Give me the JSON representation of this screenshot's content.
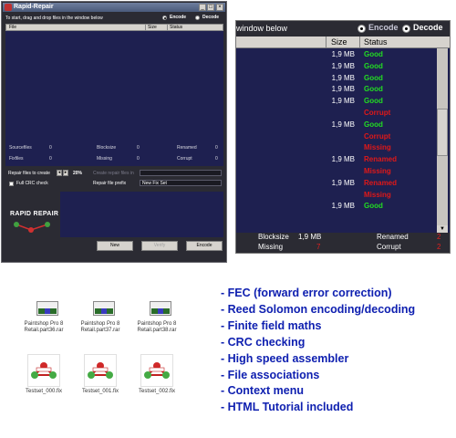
{
  "window": {
    "title": "Rapid-Repair",
    "instruction": "To start, drag and drop files in the window below",
    "encode_label": "Encode",
    "decode_label": "Decode",
    "columns": {
      "file": "File",
      "size": "Size",
      "status": "Status"
    },
    "stats": {
      "sourcefiles_label": "Sourcefiles",
      "sourcefiles": "0",
      "fixfiles_label": "Fixfiles",
      "fixfiles": "0",
      "blocksize_label": "Blocksize",
      "blocksize": "0",
      "missing_label": "Missing",
      "missing": "0",
      "renamed_label": "Renamed",
      "renamed": "0",
      "corrupt_label": "Corrupt",
      "corrupt": "0"
    },
    "repair_files_label": "Repair files to create",
    "repair_percent": "20%",
    "create_repair_label": "Create repair files in",
    "full_crc_label": "Full CRC check",
    "prefix_label": "Repair file prefix",
    "prefix_value": "New Fix Set",
    "logo_text": "RAPID REPAIR",
    "buttons": {
      "new": "New",
      "verify": "Verify",
      "encode": "Encode"
    }
  },
  "zoom": {
    "instruction_tail": "window below",
    "encode_label": "Encode",
    "decode_label": "Decode",
    "columns": {
      "size": "Size",
      "status": "Status"
    },
    "rows": [
      {
        "size": "1,9 MB",
        "status": "Good"
      },
      {
        "size": "1,9 MB",
        "status": "Good"
      },
      {
        "size": "1,9 MB",
        "status": "Good"
      },
      {
        "size": "1,9 MB",
        "status": "Good"
      },
      {
        "size": "1,9 MB",
        "status": "Good"
      },
      {
        "size": "",
        "status": "Corrupt"
      },
      {
        "size": "1,9 MB",
        "status": "Good"
      },
      {
        "size": "",
        "status": "Corrupt"
      },
      {
        "size": "",
        "status": "Missing"
      },
      {
        "size": "1,9 MB",
        "status": "Renamed"
      },
      {
        "size": "",
        "status": "Missing"
      },
      {
        "size": "1,9 MB",
        "status": "Renamed"
      },
      {
        "size": "",
        "status": "Missing"
      },
      {
        "size": "1,9 MB",
        "status": "Good"
      }
    ],
    "blocksize_label": "Blocksize",
    "blocksize": "1,9 MB",
    "missing_label": "Missing",
    "missing": "7",
    "renamed_label": "Renamed",
    "renamed": "2",
    "corrupt_label": "Corrupt",
    "corrupt": "2"
  },
  "status_colors": {
    "Good": "#22dd22",
    "Corrupt": "#e01818",
    "Missing": "#e01818",
    "Renamed": "#e01818"
  },
  "files": [
    {
      "name": "Paintshop Pro 8 Retail.part36.rar",
      "icon": "rar-archive-icon"
    },
    {
      "name": "Paintshop Pro 8 Retail.part37.rar",
      "icon": "rar-archive-icon"
    },
    {
      "name": "Paintshop Pro 8 Retail.part38.rar",
      "icon": "rar-archive-icon"
    },
    {
      "name": "Testset_000.fix",
      "icon": "fix-file-icon"
    },
    {
      "name": "Testset_001.fix",
      "icon": "fix-file-icon"
    },
    {
      "name": "Testset_002.fix",
      "icon": "fix-file-icon"
    }
  ],
  "features": [
    "- FEC (forward error correction)",
    "- Reed Solomon encoding/decoding",
    "- Finite field maths",
    "- CRC checking",
    "- High speed assembler",
    "- File associations",
    "- Context menu",
    "- HTML Tutorial included"
  ]
}
